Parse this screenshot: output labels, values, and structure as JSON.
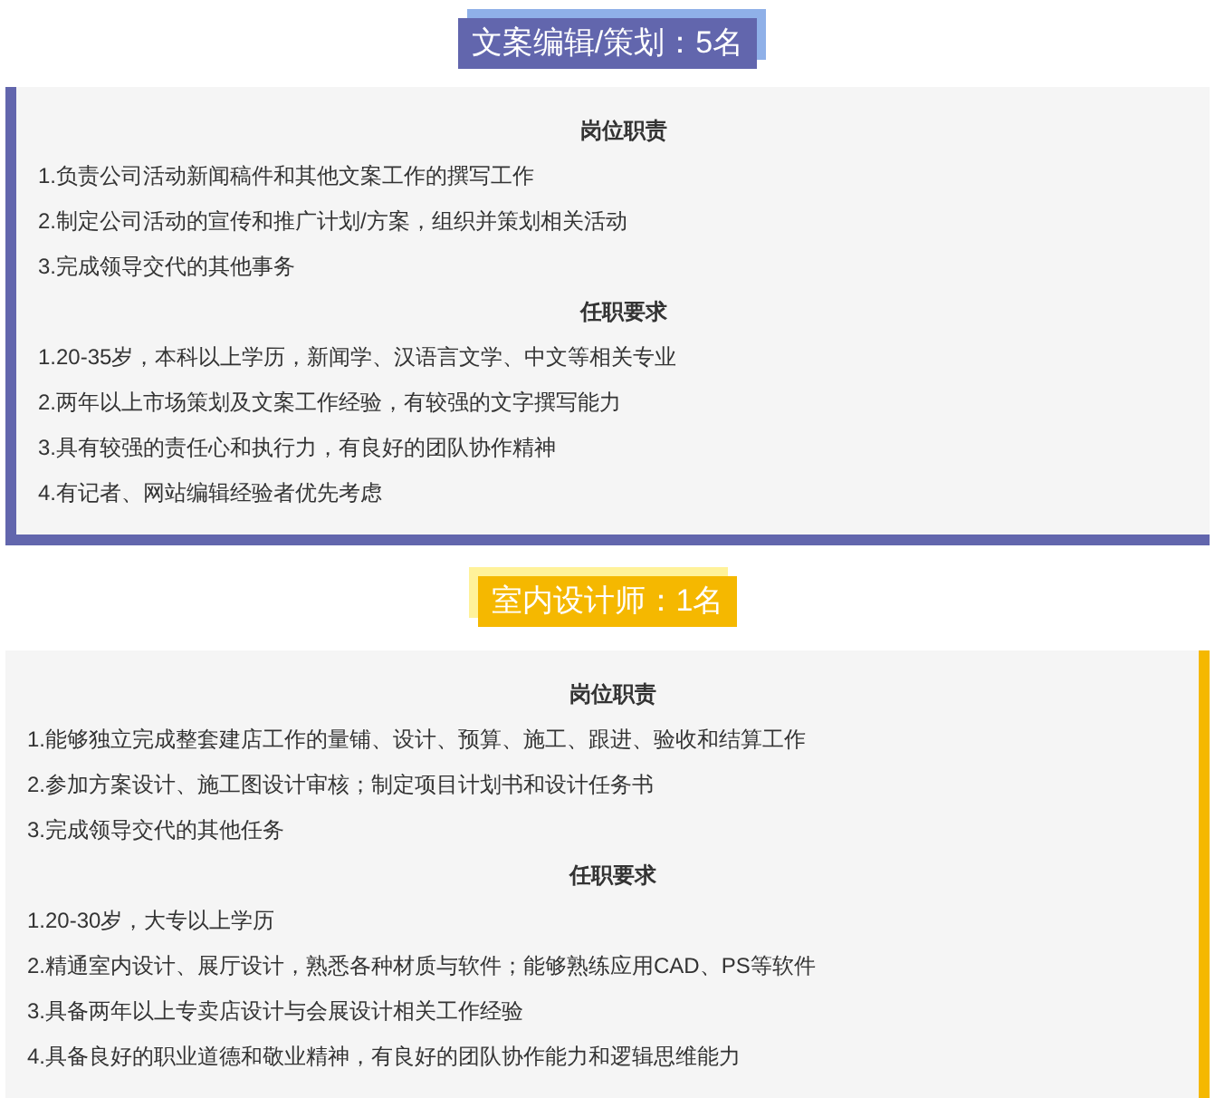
{
  "sections": [
    {
      "title": "文案编辑/策划：5名",
      "kind": "left-accent",
      "color": "#6266ad",
      "groups": [
        {
          "heading": "岗位职责",
          "items": [
            "1.负责公司活动新闻稿件和其他文案工作的撰写工作",
            "2.制定公司活动的宣传和推广计划/方案，组织并策划相关活动",
            "3.完成领导交代的其他事务"
          ]
        },
        {
          "heading": "任职要求",
          "items": [
            "1.20-35岁，本科以上学历，新闻学、汉语言文学、中文等相关专业",
            "2.两年以上市场策划及文案工作经验，有较强的文字撰写能力",
            "3.具有较强的责任心和执行力，有良好的团队协作精神",
            "4.有记者、网站编辑经验者优先考虑"
          ]
        }
      ]
    },
    {
      "title": "室内设计师：1名",
      "kind": "right-accent",
      "color": "#f5b800",
      "groups": [
        {
          "heading": "岗位职责",
          "items": [
            "1.能够独立完成整套建店工作的量铺、设计、预算、施工、跟进、验收和结算工作",
            "2.参加方案设计、施工图设计审核；制定项目计划书和设计任务书",
            "3.完成领导交代的其他任务"
          ]
        },
        {
          "heading": "任职要求",
          "items": [
            "1.20-30岁，大专以上学历",
            "2.精通室内设计、展厅设计，熟悉各种材质与软件；能够熟练应用CAD、PS等软件",
            "3.具备两年以上专卖店设计与会展设计相关工作经验",
            "4.具备良好的职业道德和敬业精神，有良好的团队协作能力和逻辑思维能力"
          ]
        }
      ]
    }
  ]
}
